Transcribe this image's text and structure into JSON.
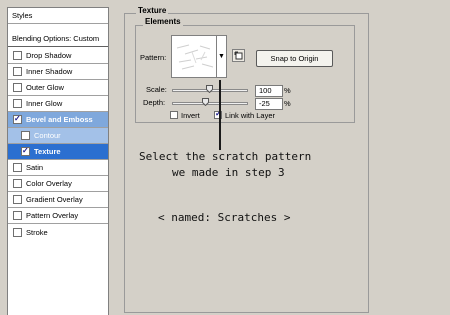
{
  "styles_panel": {
    "header": "Styles",
    "blending": "Blending Options: Custom",
    "items": [
      {
        "label": "Drop Shadow",
        "checked": false
      },
      {
        "label": "Inner Shadow",
        "checked": false
      },
      {
        "label": "Outer Glow",
        "checked": false
      },
      {
        "label": "Inner Glow",
        "checked": false
      },
      {
        "label": "Bevel and Emboss",
        "checked": true
      },
      {
        "label": "Contour",
        "checked": false
      },
      {
        "label": "Texture",
        "checked": true
      },
      {
        "label": "Satin",
        "checked": false
      },
      {
        "label": "Color Overlay",
        "checked": false
      },
      {
        "label": "Gradient Overlay",
        "checked": false
      },
      {
        "label": "Pattern Overlay",
        "checked": false
      },
      {
        "label": "Stroke",
        "checked": false
      }
    ],
    "highlight_colors": {
      "bevel": "#7fa8dc",
      "contour": "#a3c1e8",
      "texture": "#2b6fd0"
    }
  },
  "texture": {
    "section_title": "Texture",
    "group_title": "Elements",
    "pattern_label": "Pattern:",
    "snap_button": "Snap to Origin",
    "scale_label": "Scale:",
    "scale_value": "100",
    "scale_unit": "%",
    "depth_label": "Depth:",
    "depth_value": "-25",
    "depth_unit": "%",
    "invert_label": "Invert",
    "invert_checked": false,
    "link_label": "Link with Layer",
    "link_checked": true
  },
  "annotation": {
    "line1": "Select the scratch pattern",
    "line2": "we made in step 3",
    "line3": "< named: Scratches >"
  }
}
